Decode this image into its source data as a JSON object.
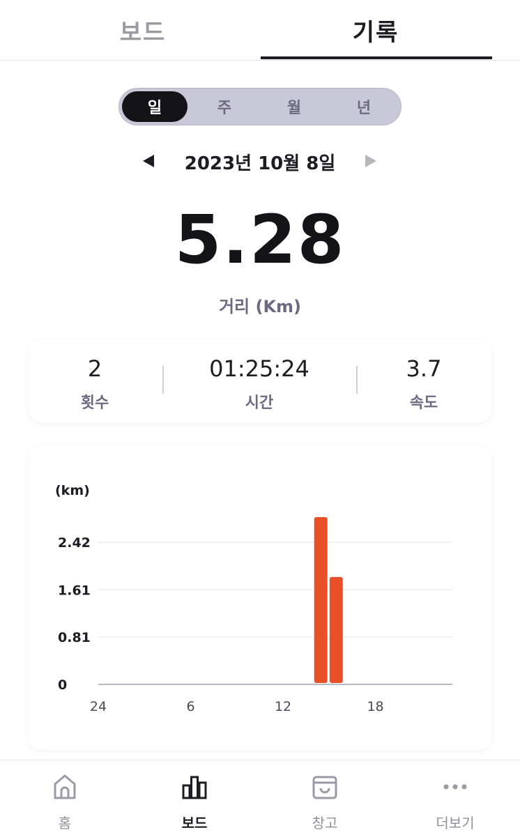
{
  "top_tabs": {
    "board": "보드",
    "record": "기록",
    "active": "record"
  },
  "period_segment": {
    "items": [
      "일",
      "주",
      "월",
      "년"
    ],
    "selected": "일"
  },
  "date_nav": {
    "date": "2023년 10월 8일"
  },
  "summary": {
    "distance": "5.28",
    "distance_label": "거리 (Km)"
  },
  "stats": [
    {
      "value": "2",
      "label": "횟수"
    },
    {
      "value": "01:25:24",
      "label": "시간"
    },
    {
      "value": "3.7",
      "label": "속도"
    }
  ],
  "chart_data": {
    "type": "bar",
    "ylabel": "(km)",
    "ylim": [
      0,
      2.85
    ],
    "yticks": [
      {
        "value": 0,
        "label": "0"
      },
      {
        "value": 0.81,
        "label": "0.81"
      },
      {
        "value": 1.61,
        "label": "1.61"
      },
      {
        "value": 2.42,
        "label": "2.42"
      }
    ],
    "xlim": [
      0,
      23
    ],
    "xticks": [
      {
        "value": 0,
        "label": "24"
      },
      {
        "value": 6,
        "label": "6"
      },
      {
        "value": 12,
        "label": "12"
      },
      {
        "value": 18,
        "label": "18"
      }
    ],
    "bars": [
      {
        "hour": 14,
        "value": 2.85
      },
      {
        "hour": 15,
        "value": 1.83
      }
    ],
    "bar_color": "#e9502a",
    "grid": true
  },
  "bottom_nav": {
    "items": [
      {
        "label": "홈",
        "icon": "home-icon"
      },
      {
        "label": "보드",
        "icon": "bar-chart-icon"
      },
      {
        "label": "창고",
        "icon": "storage-box-icon"
      },
      {
        "label": "더보기",
        "icon": "more-dots-icon"
      }
    ],
    "active": "보드"
  },
  "colors": {
    "accent_dark": "#141418",
    "segment_bg": "#c9c8d8",
    "bar": "#e9502a",
    "muted_text": "#6b6a80"
  }
}
